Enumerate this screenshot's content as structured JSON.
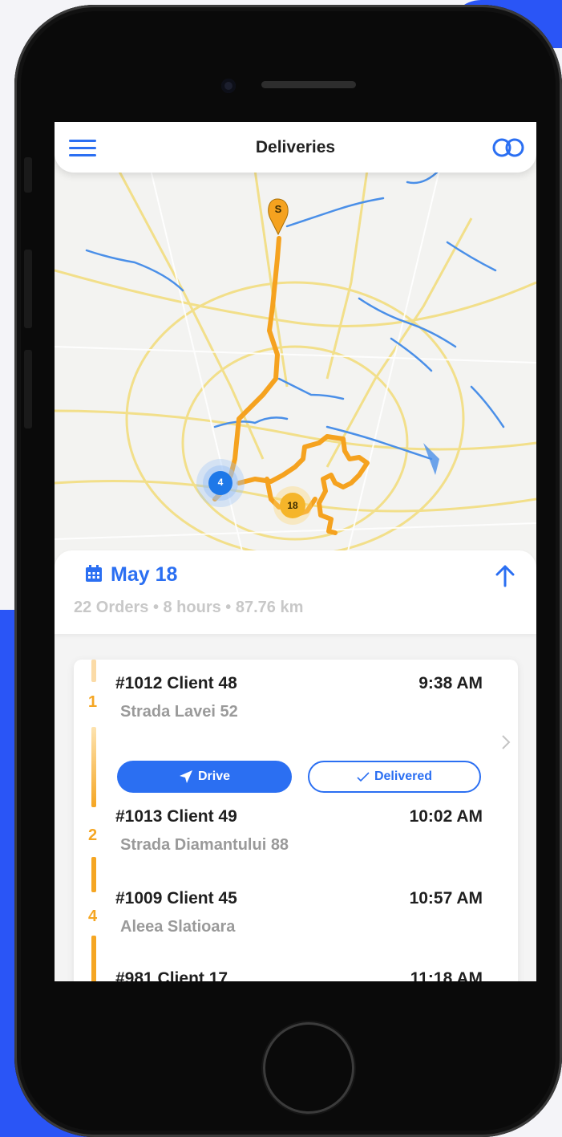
{
  "app": {
    "title": "Deliveries"
  },
  "icons": {
    "menu": "hamburger-icon",
    "toggle": "toggle-icon",
    "calendar": "calendar-icon",
    "collapse": "arrow-up-icon",
    "drive": "navigation-arrow-icon",
    "delivered": "checkmark-icon",
    "chevron": "chevron-right-icon"
  },
  "colors": {
    "accent": "#2b6ff2",
    "route": "#f5a623",
    "background_blue": "#2a55f6"
  },
  "map": {
    "start_marker": "S",
    "cluster_blue": "4",
    "cluster_orange": "18"
  },
  "day": {
    "date": "May 18",
    "summary": "22 Orders • 8 hours • 87.76 km"
  },
  "orders": [
    {
      "stop": "1",
      "id": "#1012 Client 48",
      "time": "9:38 AM",
      "address": "Strada Lavei 52"
    },
    {
      "stop": "2",
      "id": "#1013 Client 49",
      "time": "10:02 AM",
      "address": "Strada Diamantului 88"
    },
    {
      "stop": "4",
      "id": "#1009 Client 45",
      "time": "10:57 AM",
      "address": "Aleea Slatioara"
    },
    {
      "stop": "",
      "id": "#981 Client 17",
      "time": "11:18 AM",
      "address": ""
    }
  ],
  "actions": {
    "drive": "Drive",
    "delivered": "Delivered"
  }
}
